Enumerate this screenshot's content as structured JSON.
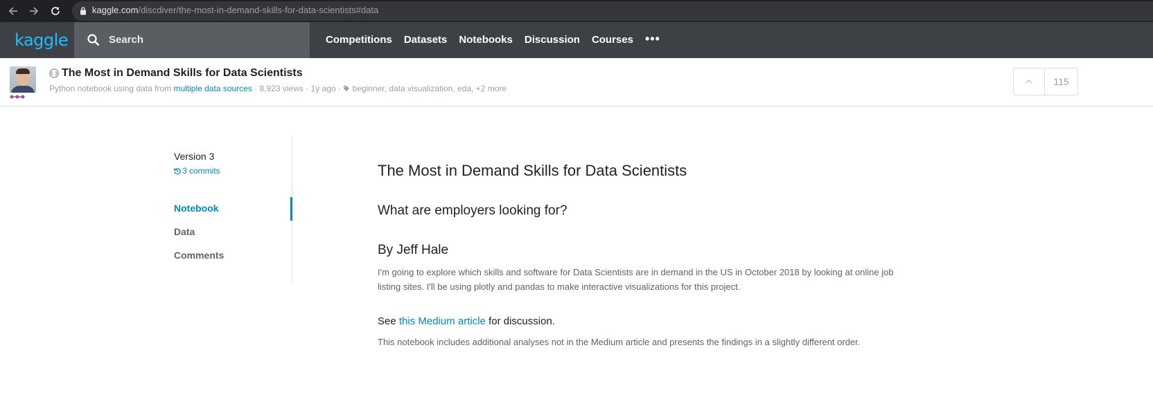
{
  "browser": {
    "url_domain": "kaggle.com",
    "url_path": "/discdiver/the-most-in-demand-skills-for-data-scientists#data"
  },
  "header": {
    "logo": "kaggle",
    "search_placeholder": "Search",
    "nav": [
      "Competitions",
      "Datasets",
      "Notebooks",
      "Discussion",
      "Courses"
    ],
    "more": "•••"
  },
  "notebook": {
    "title": "The Most in Demand Skills for Data Scientists",
    "meta_prefix": "Python notebook using data from ",
    "meta_link": "multiple data sources",
    "meta_views": " · 8,923 views · 1y ago · ",
    "meta_tags": "beginner, data visualization, eda, +2 more",
    "votes": "115"
  },
  "sidebar": {
    "version": "Version 3",
    "commits": "3 commits",
    "items": [
      "Notebook",
      "Data",
      "Comments"
    ],
    "active": "Notebook"
  },
  "content": {
    "heading": "The Most in Demand Skills for Data Scientists",
    "subheading": "What are employers looking for?",
    "author": "By Jeff Hale",
    "intro": "I'm going to explore which skills and software for Data Scientists are in demand in the US in October 2018 by looking at online job listing sites. I'll be using plotly and pandas to make interactive visualizations for this project.",
    "see_prefix": "See ",
    "see_link": "this Medium article",
    "see_suffix": " for discussion.",
    "note": "This notebook includes additional analyses not in the Medium article and presents the findings in a slightly different order."
  },
  "colors": {
    "accent": "#008abc",
    "logo": "#20beff",
    "header_bg": "#3d4044",
    "search_bg": "#5a5d61"
  }
}
